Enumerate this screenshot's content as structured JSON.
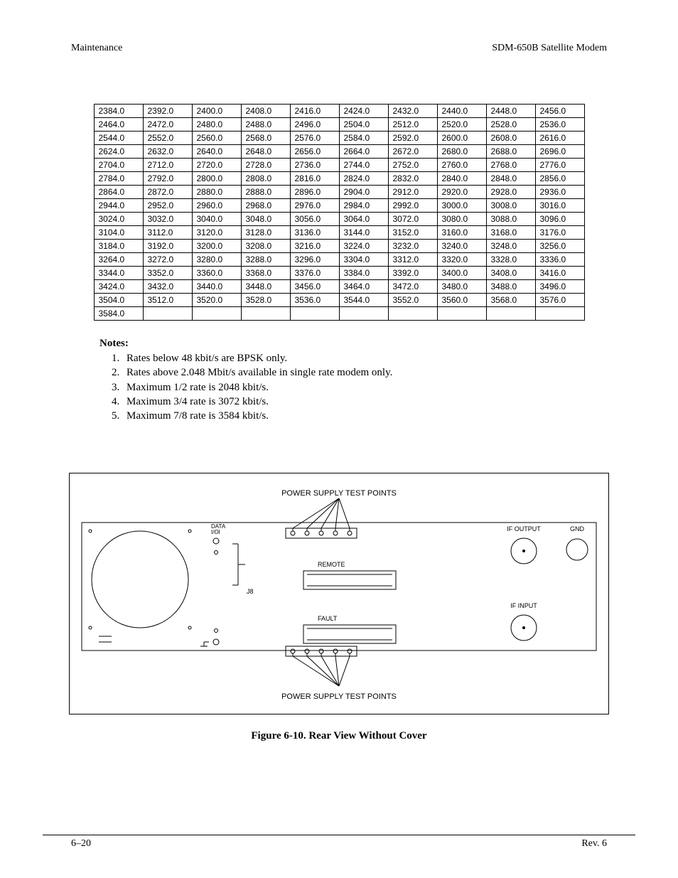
{
  "header": {
    "left": "Maintenance",
    "right": "SDM-650B Satellite Modem"
  },
  "table": {
    "start": 2384.0,
    "step": 8.0,
    "count": 151,
    "cols": 10
  },
  "notes": {
    "heading": "Notes:",
    "items": [
      "Rates below 48 kbit/s are BPSK only.",
      "Rates above 2.048 Mbit/s available in single rate modem only.",
      "Maximum 1/2 rate is 2048 kbit/s.",
      "Maximum 3/4 rate is 3072 kbit/s.",
      "Maximum 7/8 rate is 3584 kbit/s."
    ]
  },
  "figure": {
    "top_label": "POWER SUPPLY TEST POINTS",
    "bottom_label": "POWER SUPPLY TEST POINTS",
    "data_label": "DATA\nI/OI",
    "remote_label": "REMOTE",
    "fault_label": "FAULT",
    "j8_label": "J8",
    "if_output_label": "IF OUTPUT",
    "if_input_label": "IF INPUT",
    "gnd_label": "GND",
    "caption": "Figure 6-10.  Rear View Without Cover"
  },
  "footer": {
    "left": "6–20",
    "right": "Rev. 6"
  }
}
